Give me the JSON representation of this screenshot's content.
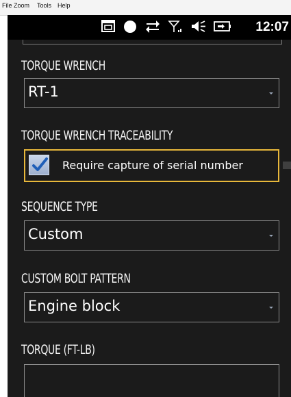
{
  "menu": {
    "items": [
      "File",
      "Zoom",
      "Tools",
      "Help"
    ]
  },
  "status_bar": {
    "time": "12:07",
    "icons": [
      "sync-window-icon",
      "record-dot-icon",
      "data-transfer-icon",
      "signal-icon",
      "speaker-icon",
      "battery-icon"
    ]
  },
  "form": {
    "torque_wrench": {
      "label": "TORQUE WRENCH",
      "value": "RT-1"
    },
    "traceability": {
      "label": "TORQUE WRENCH TRACEABILITY",
      "checkbox_label": "Require capture of serial number",
      "checked": true
    },
    "sequence_type": {
      "label": "SEQUENCE TYPE",
      "value": "Custom"
    },
    "custom_bolt_pattern": {
      "label": "CUSTOM BOLT PATTERN",
      "value": "Engine block"
    },
    "torque": {
      "label": "TORQUE (FT-LB)",
      "value": ""
    }
  },
  "colors": {
    "focus_border": "#e8b83b",
    "background": "#1b1b1b",
    "field_border": "#8d8d8d"
  }
}
